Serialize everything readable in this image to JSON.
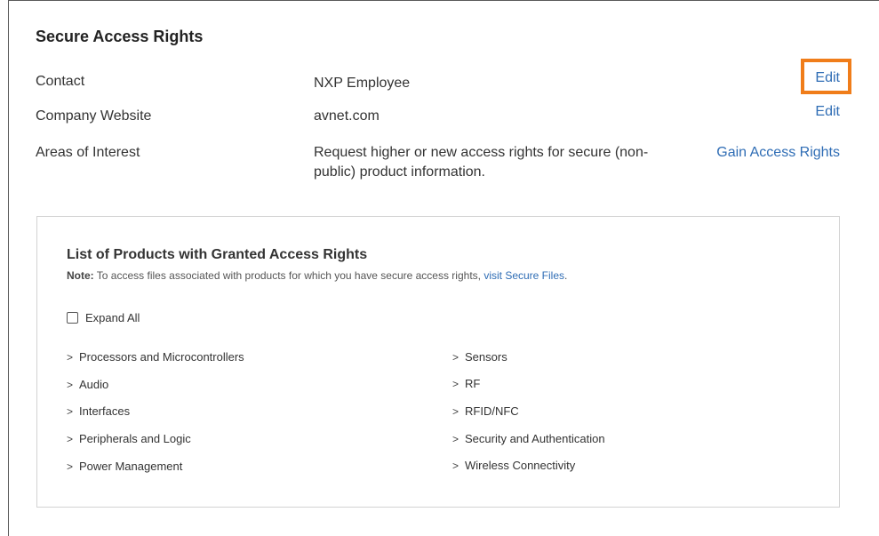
{
  "section": {
    "title": "Secure Access Rights",
    "rows": [
      {
        "label": "Contact",
        "value": "NXP Employee",
        "action": "Edit"
      },
      {
        "label": "Company Website",
        "value": "avnet.com",
        "action": "Edit"
      },
      {
        "label": "Areas of Interest",
        "value": "Request higher or new access rights for secure (non-public) product information.",
        "action": "Gain Access Rights"
      }
    ]
  },
  "panel": {
    "title": "List of Products with Granted Access Rights",
    "note_prefix": "Note:",
    "note_text": " To access files associated with products for which you have secure access rights, ",
    "note_link": "visit Secure Files",
    "note_suffix": ".",
    "expand_all": "Expand All",
    "categories_left": [
      "Processors and Microcontrollers",
      "Audio",
      "Interfaces",
      "Peripherals and Logic",
      "Power Management"
    ],
    "categories_right": [
      "Sensors",
      "RF",
      "RFID/NFC",
      "Security and Authentication",
      "Wireless Connectivity"
    ]
  },
  "colors": {
    "link": "#2f6db5",
    "highlight": "#f07d1a"
  },
  "icons": {
    "category_chevron": "chevron-right-icon",
    "expand_checkbox": "checkbox-unchecked"
  }
}
